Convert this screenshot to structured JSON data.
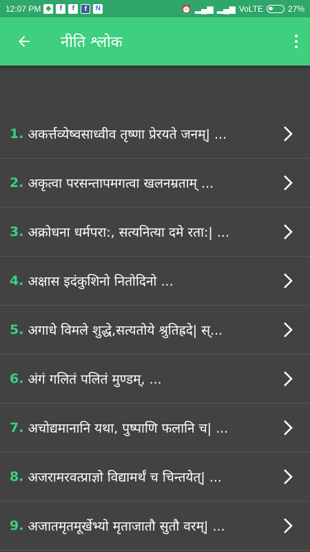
{
  "status_bar": {
    "time": "12:07 PM",
    "network": "VoLTE",
    "battery": "27%"
  },
  "appbar": {
    "title": "नीति श्लोक"
  },
  "items": [
    {
      "number": "1.",
      "text": "अकर्त्तव्येष्वसाध्वीव तृष्णा प्रेरयते जनम्|  ..."
    },
    {
      "number": "2.",
      "text": "अकृत्वा परसन्तापमगत्वा खलनम्रताम्  ..."
    },
    {
      "number": "3.",
      "text": "अक्रोधना धर्मपरा:, सत्यनित्या दमे रता:| ..."
    },
    {
      "number": "4.",
      "text": "अक्षास इदंकुशिनो नितोदिनो ..."
    },
    {
      "number": "5.",
      "text": "अगाधे विमले शुद्धे,सत्यतोये श्रुतिह्रदे|        स्..."
    },
    {
      "number": "6.",
      "text": "अंगं गलितं पलितं मुण्डम्, ..."
    },
    {
      "number": "7.",
      "text": "अचोद्यमानानि यथा, पुष्पाणि फलानि च| ..."
    },
    {
      "number": "8.",
      "text": "अजरामरवत्प्राज्ञो विद्यामर्थं च चिन्तयेत्|      ..."
    },
    {
      "number": "9.",
      "text": "अजातमृतमूर्खेभ्यो मृताजातौ सुतौ वरम्|    ..."
    }
  ],
  "colors": {
    "accent": "#3ecf7f",
    "status_bar": "#2fa66a",
    "background": "#424242"
  }
}
